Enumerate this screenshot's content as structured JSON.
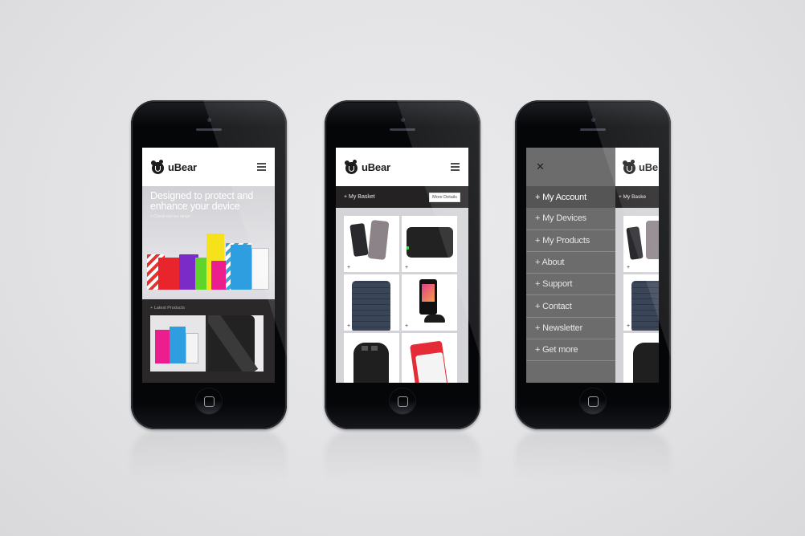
{
  "brand": {
    "name": "uBear",
    "logo_icon": "bear-head-icon"
  },
  "colors": {
    "menu_bg": "#6c6c6c",
    "menu_active": "#555555",
    "dark_bar": "#242222",
    "grid_bg": "#d4d4d8"
  },
  "screen_home": {
    "hero_title_line1": "Designed to protect and",
    "hero_title_line2": "enhance your device",
    "hero_link": "+ Check out our range",
    "latest_label": "+ Latest Products"
  },
  "screen_shop": {
    "basket_label": "+ My Basket",
    "more_details_label": "More Details",
    "products": [
      {
        "name": "iPhone cases (dark and clear)",
        "plus": "+"
      },
      {
        "name": "Black laptop sleeve",
        "plus": "+"
      },
      {
        "name": "Woven navy iPhone case",
        "plus": "+"
      },
      {
        "name": "Car phone mount",
        "plus": "+"
      },
      {
        "name": "Black USB car charger",
        "plus": ""
      },
      {
        "name": "Red UK plug USB charger",
        "plus": ""
      }
    ]
  },
  "screen_menu": {
    "close_label": "✕",
    "items": [
      {
        "label": "+ My Account",
        "active": true
      },
      {
        "label": "+ My Devices"
      },
      {
        "label": "+ My Products"
      },
      {
        "label": "+ About"
      },
      {
        "label": "+ Support"
      },
      {
        "label": "+ Contact"
      },
      {
        "label": "+ Newsletter"
      },
      {
        "label": "+ Get more"
      }
    ],
    "peek_brand": "uBe",
    "peek_basket": "+ My Baske"
  }
}
